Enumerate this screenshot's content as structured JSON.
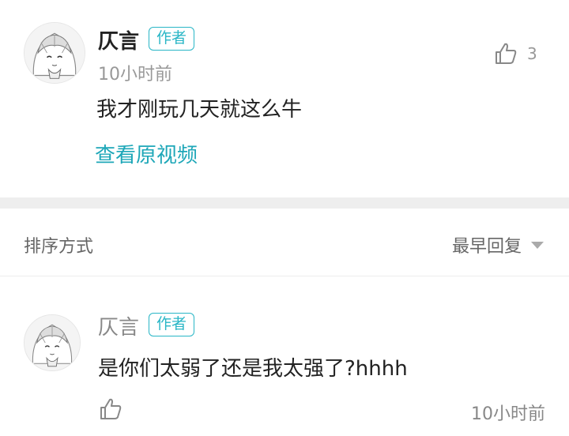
{
  "comment": {
    "author": "仄言",
    "badge": "作者",
    "time": "10小时前",
    "like_count": "3",
    "text": "我才刚玩几天就这么牛",
    "view_video_link": "查看原视频"
  },
  "sort": {
    "label": "排序方式",
    "value": "最早回复"
  },
  "reply": {
    "author": "仄言",
    "badge": "作者",
    "text": "是你们太弱了还是我太强了?hhhh",
    "time": "10小时前"
  },
  "icons": {
    "like": "thumbs-up-icon",
    "dropdown": "caret-down-icon"
  },
  "colors": {
    "accent": "#29b6c6",
    "link": "#1ea7b8",
    "muted": "#999999",
    "divider": "#eeeeee"
  }
}
